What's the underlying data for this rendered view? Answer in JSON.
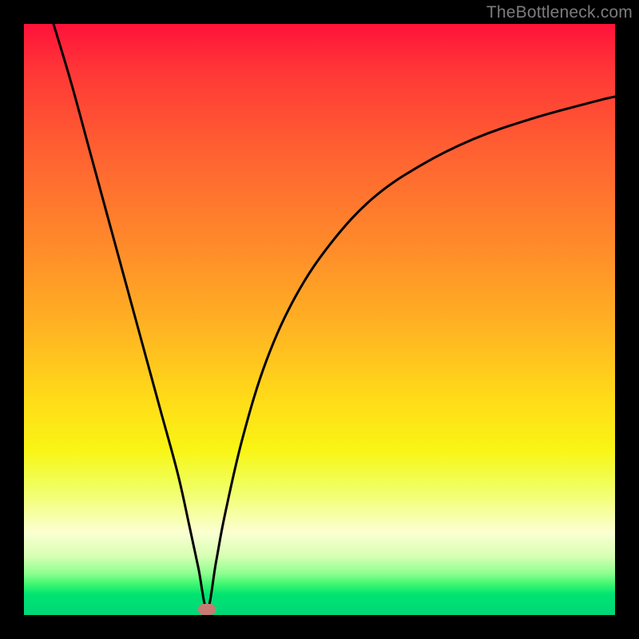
{
  "watermark": "TheBottleneck.com",
  "chart_data": {
    "type": "line",
    "title": "",
    "xlabel": "",
    "ylabel": "",
    "xlim": [
      0,
      100
    ],
    "ylim": [
      0,
      100
    ],
    "background_gradient": {
      "top": "#ff123a",
      "bottom": "#00d777",
      "meaning": "red-high to green-low bottleneck zone"
    },
    "marker": {
      "x": 31,
      "y": 1,
      "color": "#c97a72"
    },
    "series": [
      {
        "name": "bottleneck-curve",
        "color": "#000000",
        "x": [
          5,
          8,
          11,
          14,
          17,
          20,
          23,
          26,
          28,
          29.5,
          31,
          32.5,
          34,
          37,
          41,
          46,
          52,
          59,
          67,
          76,
          86,
          97,
          100
        ],
        "y": [
          100,
          90,
          79,
          68,
          57,
          46,
          35,
          24,
          15,
          8,
          1,
          9,
          17,
          30,
          43,
          54,
          63,
          70.5,
          76,
          80.5,
          84,
          87,
          87.7
        ]
      }
    ]
  }
}
